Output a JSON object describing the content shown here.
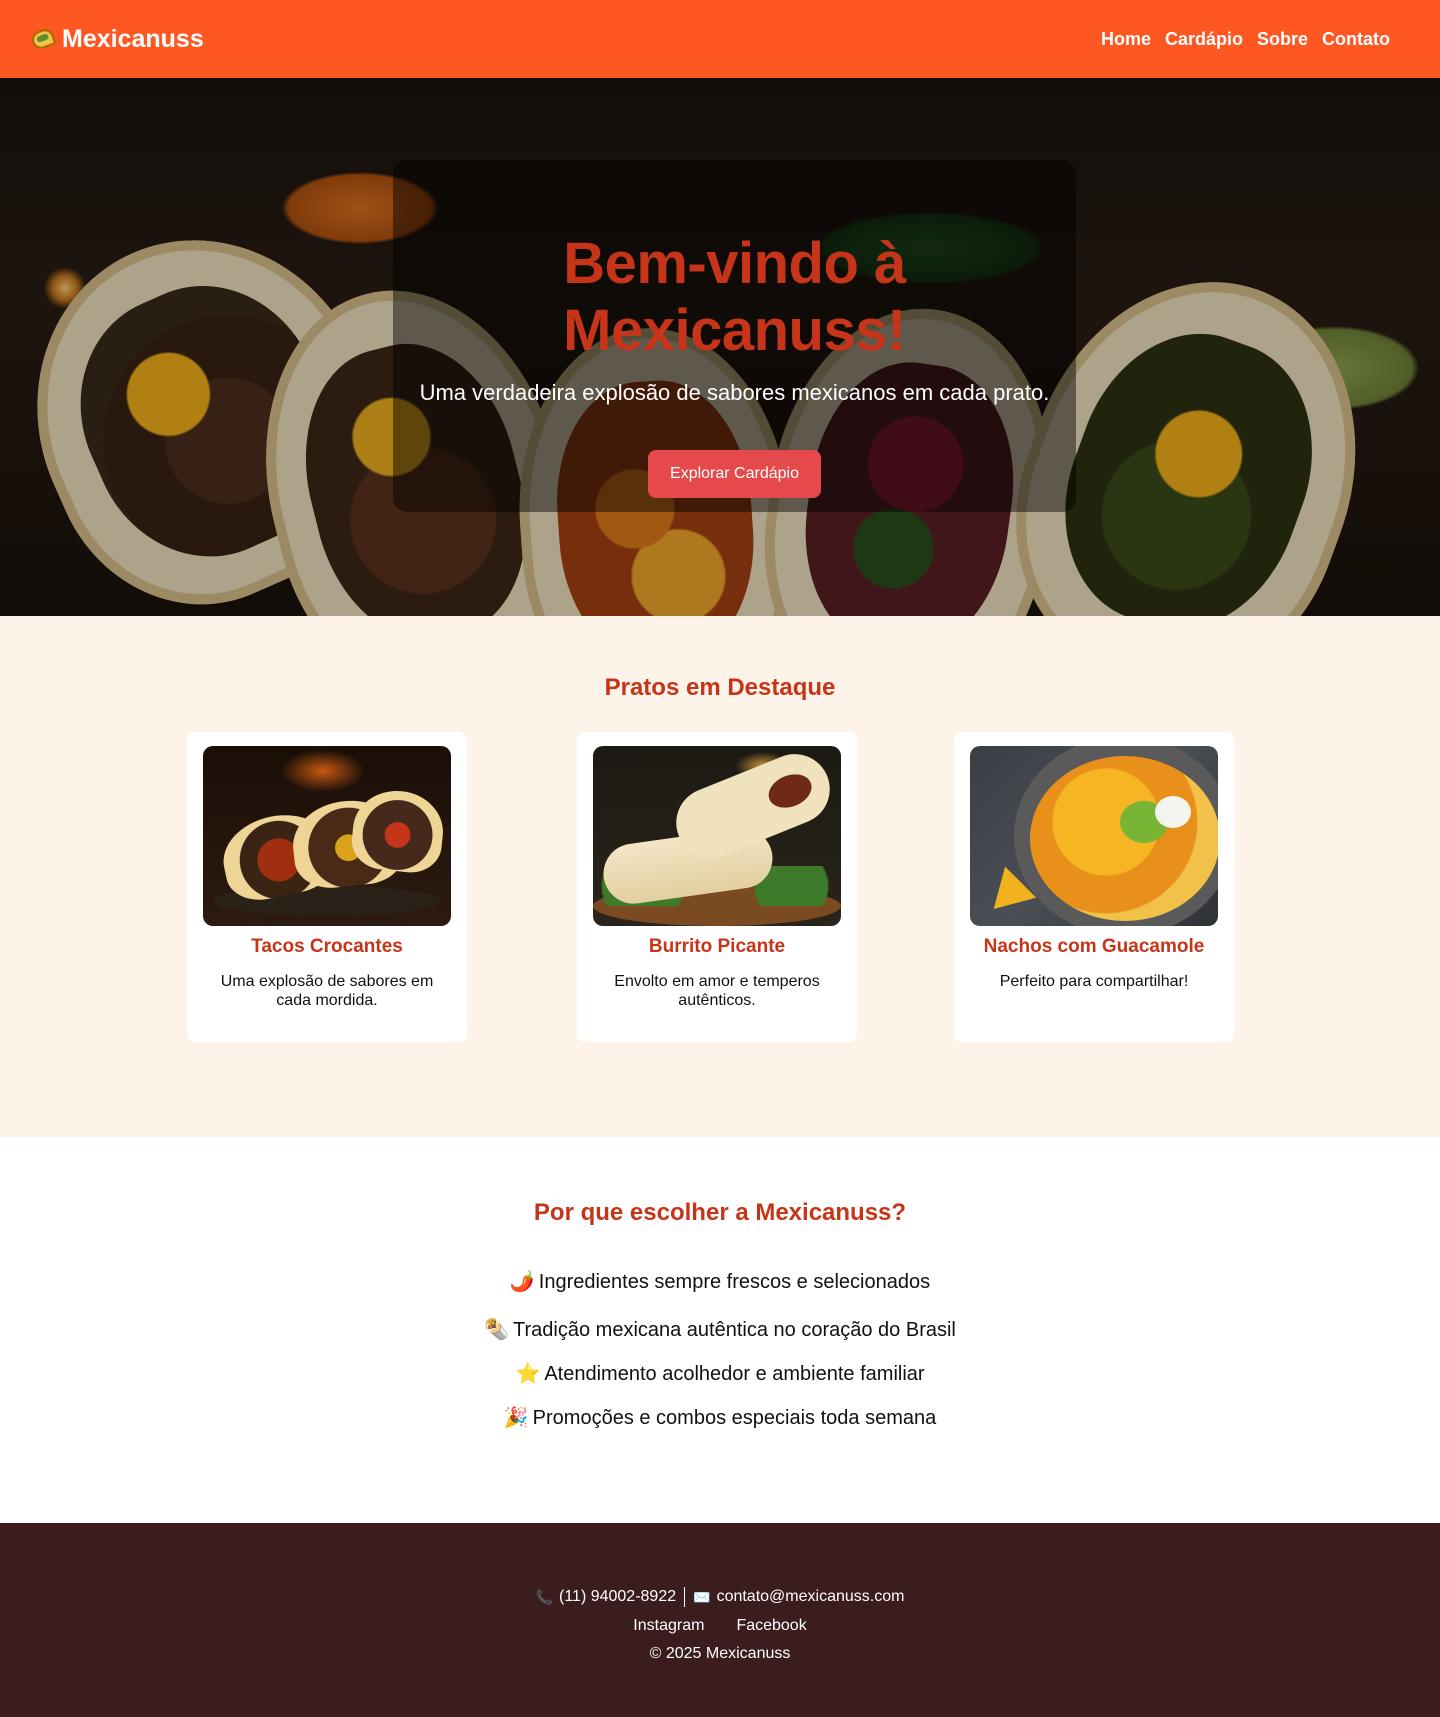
{
  "header": {
    "brand": "Mexicanuss",
    "logo_icon": "taco-icon",
    "nav": [
      {
        "label": "Home"
      },
      {
        "label": "Cardápio"
      },
      {
        "label": "Sobre"
      },
      {
        "label": "Contato"
      }
    ]
  },
  "hero": {
    "title": "Bem-vindo à Mexicanuss!",
    "subtitle": "Uma verdadeira explosão de sabores mexicanos em cada prato.",
    "button": "Explorar Cardápio"
  },
  "featured": {
    "title": "Pratos em Destaque",
    "items": [
      {
        "name": "Tacos Crocantes",
        "desc": "Uma explosão de sabores em cada mordida."
      },
      {
        "name": "Burrito Picante",
        "desc": "Envolto em amor e temperos autênticos."
      },
      {
        "name": "Nachos com Guacamole",
        "desc": "Perfeito para compartilhar!"
      }
    ]
  },
  "why": {
    "title": "Por que escolher a Mexicanuss?",
    "items": [
      {
        "icon": "🌶️",
        "text": "Ingredientes sempre frescos e selecionados"
      },
      {
        "icon": "🌯",
        "text": "Tradição mexicana autêntica no coração do Brasil"
      },
      {
        "icon": "⭐",
        "text": "Atendimento acolhedor e ambiente familiar"
      },
      {
        "icon": "🎉",
        "text": "Promoções e combos especiais toda semana"
      }
    ]
  },
  "footer": {
    "phone_icon": "📞",
    "phone": "(11) 94002-8922",
    "email_icon": "✉️",
    "email": "contato@mexicanuss.com",
    "links": [
      {
        "label": "Instagram"
      },
      {
        "label": "Facebook"
      }
    ],
    "copyright": "© 2025 Mexicanuss"
  },
  "colors": {
    "header": "#ff5722",
    "accent": "#c6351a",
    "button": "#e6494b",
    "featured_bg": "#fdf3e8",
    "footer_bg": "#3b1d1e"
  }
}
